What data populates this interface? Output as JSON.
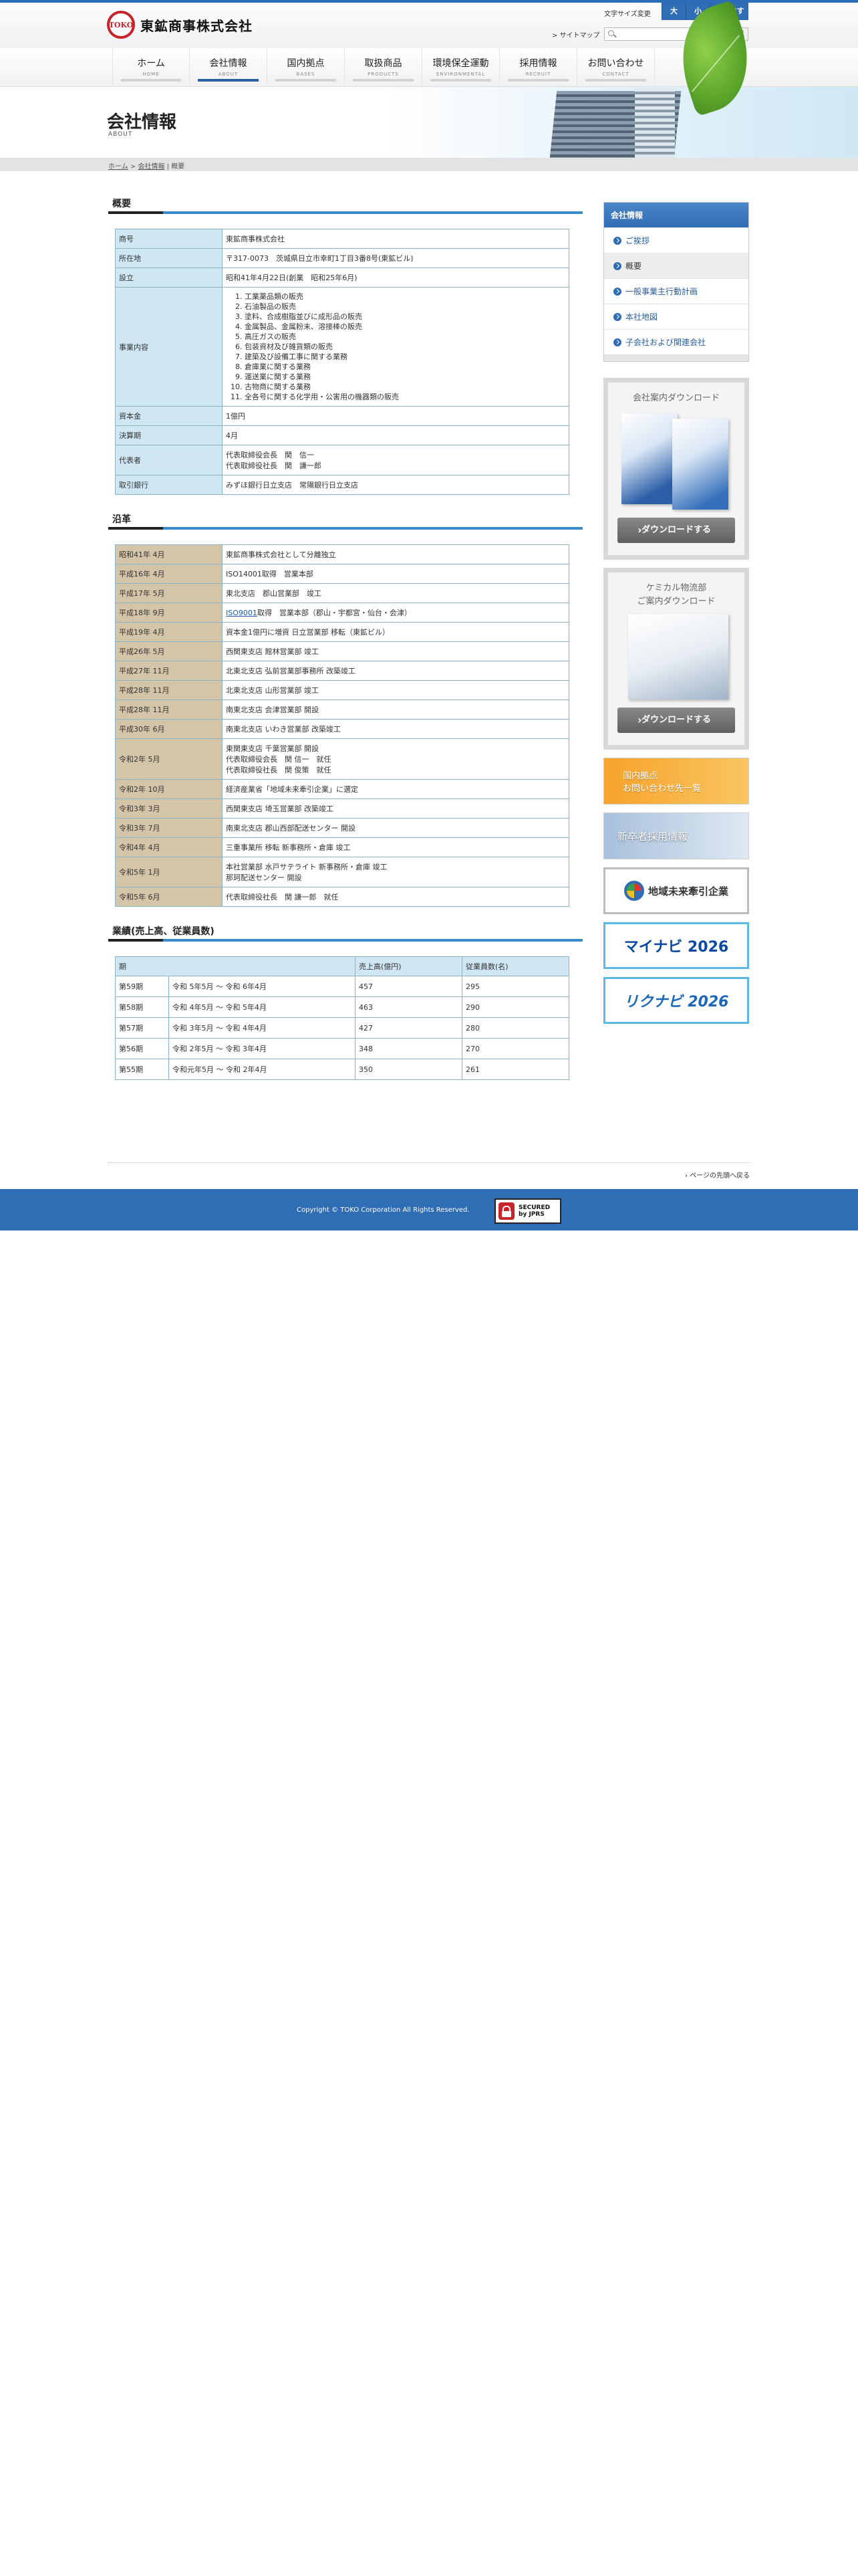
{
  "header": {
    "logo_mark": "TOKO",
    "company_name": "東鉱商事株式会社",
    "font_size_label": "文字サイズ変更",
    "font_large": "大",
    "font_small": "小",
    "font_reset": "元に戻す",
    "sitemap": "> サイトマップ",
    "search_placeholder": "",
    "search_button": "検索"
  },
  "nav": [
    {
      "label": "ホーム",
      "en": "HOME"
    },
    {
      "label": "会社情報",
      "en": "ABOUT"
    },
    {
      "label": "国内拠点",
      "en": "BASES"
    },
    {
      "label": "取扱商品",
      "en": "PRODUCTS"
    },
    {
      "label": "環境保全運動",
      "en": "ENVIRONMENTAL"
    },
    {
      "label": "採用情報",
      "en": "RECRUIT"
    },
    {
      "label": "お問い合わせ",
      "en": "CONTACT"
    }
  ],
  "hero": {
    "title": "会社情報",
    "subtitle": "ABOUT"
  },
  "breadcrumb": {
    "home": "ホーム",
    "sep1": ">",
    "about": "会社情報",
    "sep2": "|",
    "current": "概要"
  },
  "overview": {
    "heading": "概要",
    "rows": [
      {
        "label": "商号",
        "value": "東鉱商事株式会社"
      },
      {
        "label": "所在地",
        "value": "〒317-0073　茨城県日立市幸町1丁目3番8号(東鉱ビル)"
      },
      {
        "label": "設立",
        "value": "昭和41年4月22日(創業　昭和25年6月)"
      },
      {
        "label": "資本金",
        "value": "1億円"
      },
      {
        "label": "決算期",
        "value": "4月"
      },
      {
        "label": "代表者",
        "value": "代表取締役会長　関　信一\n代表取締役社長　関　謙一郎"
      },
      {
        "label": "取引銀行",
        "value": "みずほ銀行日立支店　常陽銀行日立支店"
      }
    ],
    "business_label": "事業内容",
    "business_items": [
      "工業薬品類の販売",
      "石油製品の販売",
      "塗料、合成樹脂並びに成形品の販売",
      "金属製品、金属粉末、溶接棒の販売",
      "高圧ガスの販売",
      "包装資材及び雑貨類の販売",
      "建築及び設備工事に関する業務",
      "倉庫業に関する業務",
      "運送業に関する業務",
      "古物商に関する業務",
      "全各号に関する化学用・公害用の機器類の販売"
    ]
  },
  "history": {
    "heading": "沿革",
    "rows": [
      {
        "date": "昭和41年 4月",
        "event": "東鉱商事株式会社として分離独立"
      },
      {
        "date": "平成16年 4月",
        "event": "ISO14001取得　営業本部"
      },
      {
        "date": "平成17年 5月",
        "event": "東北支店　郡山営業部　竣工"
      },
      {
        "date": "平成18年 9月",
        "event_link": "ISO9001",
        "event": "取得　営業本部（郡山・宇都宮・仙台・会津）"
      },
      {
        "date": "平成19年 4月",
        "event": "資本金1億円に増資 日立営業部 移転（東鉱ビル）"
      },
      {
        "date": "平成26年 5月",
        "event": "西関東支店 館林営業部 竣工"
      },
      {
        "date": "平成27年 11月",
        "event": "北東北支店 弘前営業部事務所 改築竣工"
      },
      {
        "date": "平成28年 11月",
        "event": "北東北支店 山形営業部 竣工"
      },
      {
        "date": "平成28年 11月",
        "event": "南東北支店 会津営業部 開設"
      },
      {
        "date": "平成30年 6月",
        "event": "南東北支店 いわき営業部 改築竣工"
      },
      {
        "date": "令和2年 5月",
        "event": "東関東支店 千葉営業部 開設\n代表取締役会長　関 信一　就任\n代表取締役社長　関 俊策　就任"
      },
      {
        "date": "令和2年 10月",
        "event": "経済産業省「地域未来牽引企業」に選定"
      },
      {
        "date": "令和3年 3月",
        "event": "西関東支店 埼玉営業部 改築竣工"
      },
      {
        "date": "令和3年 7月",
        "event": "南東北支店 郡山西部配送センター 開設"
      },
      {
        "date": "令和4年 4月",
        "event": "三重事業所 移転 新事務所・倉庫 竣工"
      },
      {
        "date": "令和5年 1月",
        "event": "本社営業部 水戸サテライト 新事務所・倉庫 竣工\n那珂配送センター 開設"
      },
      {
        "date": "令和5年 6月",
        "event": "代表取締役社長　関 謙一郎　就任"
      }
    ]
  },
  "results": {
    "heading": "業績(売上高、従業員数)",
    "headers": [
      "期",
      "",
      "売上高(億円)",
      "従業員数(名)"
    ],
    "rows": [
      {
        "term": "第59期",
        "period": "令和 5年5月 ～ 令和 6年4月",
        "sales": "457",
        "employees": "295"
      },
      {
        "term": "第58期",
        "period": "令和 4年5月 ～ 令和 5年4月",
        "sales": "463",
        "employees": "290"
      },
      {
        "term": "第57期",
        "period": "令和 3年5月 ～ 令和 4年4月",
        "sales": "427",
        "employees": "280"
      },
      {
        "term": "第56期",
        "period": "令和 2年5月 ～ 令和 3年4月",
        "sales": "348",
        "employees": "270"
      },
      {
        "term": "第55期",
        "period": "令和元年5月 ～ 令和 2年4月",
        "sales": "350",
        "employees": "261"
      }
    ]
  },
  "sidebar": {
    "heading": "会社情報",
    "items": [
      "ご挨拶",
      "概要",
      "一般事業主行動計画",
      "本社地図",
      "子会社および関連会社"
    ],
    "dl1_title": "会社案内ダウンロード",
    "dl2_title_1": "ケミカル物流部",
    "dl2_title_2": "ご案内ダウンロード",
    "dl_button": "ダウンロードする",
    "banner_bases_1": "国内拠点",
    "banner_bases_2": "お問い合わせ先一覧",
    "banner_recruit": "新卒者採用情報",
    "banner_chiiki": "地域未来牽引企業",
    "banner_mynavi": "マイナビ 2026",
    "banner_rikunabi": "リクナビ 2026"
  },
  "footer": {
    "pagetop": "ページの先頭へ戻る",
    "copyright": "Copyright © TOKO Corporation All Rights Reserved.",
    "ssl_1": "SECURED",
    "ssl_2": "by JPRS"
  }
}
